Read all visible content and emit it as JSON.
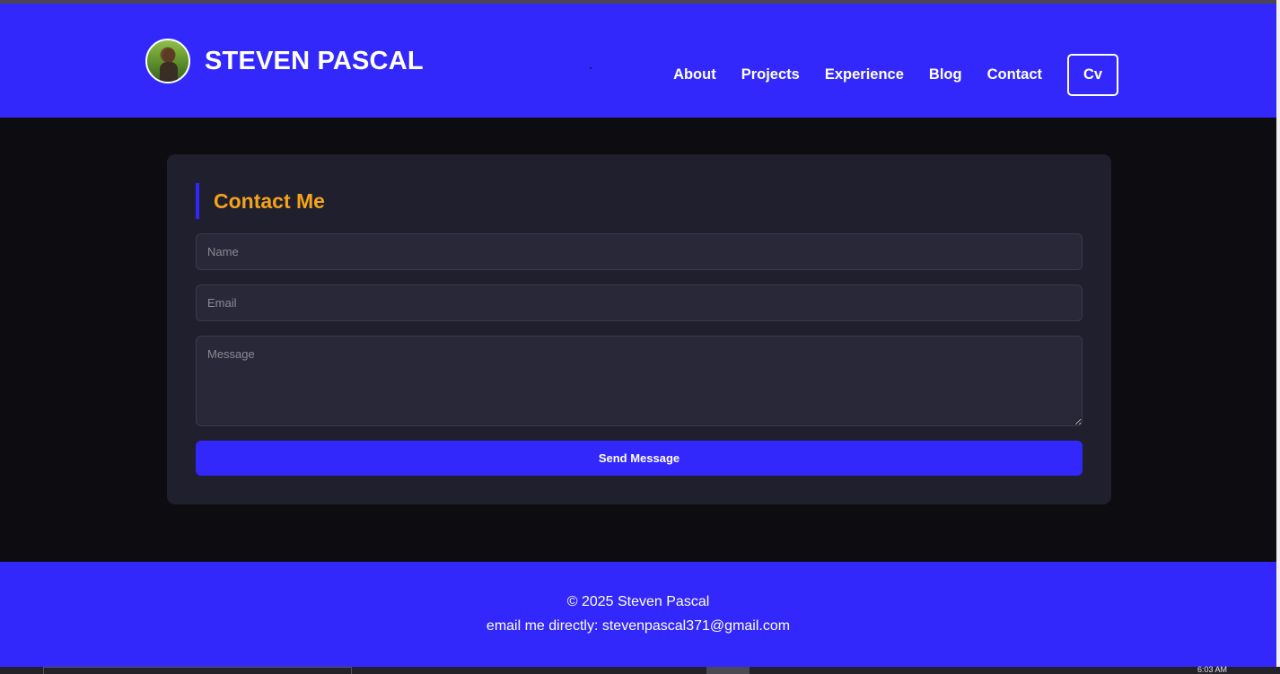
{
  "header": {
    "brand_name": "STEVEN PASCAL",
    "nav": [
      {
        "label": "About"
      },
      {
        "label": "Projects"
      },
      {
        "label": "Experience"
      },
      {
        "label": "Blog"
      },
      {
        "label": "Contact"
      }
    ],
    "cv_label": "Cv"
  },
  "contact": {
    "title": "Contact Me",
    "name_placeholder": "Name",
    "email_placeholder": "Email",
    "message_placeholder": "Message",
    "send_label": "Send Message"
  },
  "footer": {
    "copyright": "© 2025 Steven Pascal",
    "email_line": "email me directly: stevenpascal371@gmail.com"
  },
  "taskbar": {
    "clock": "6:03 AM"
  },
  "colors": {
    "header_bg": "#3328fc",
    "page_bg": "#0d0d11",
    "card_bg": "#1f1f2e",
    "title_accent": "#f5a31a"
  }
}
